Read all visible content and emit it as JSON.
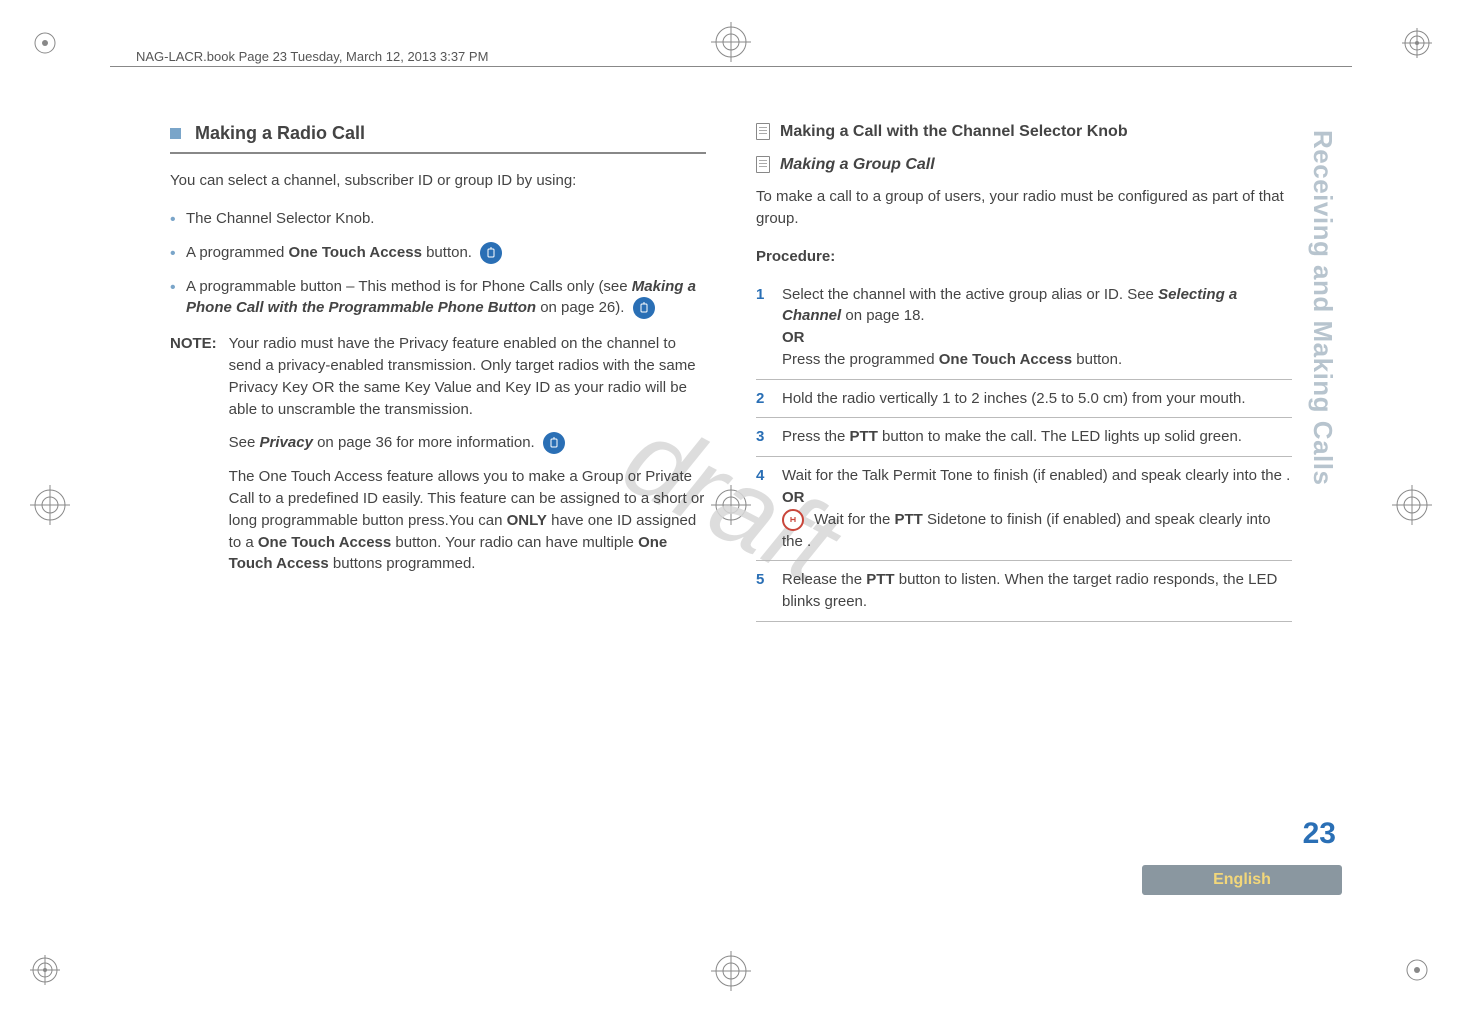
{
  "meta": {
    "header_line": "NAG-LACR.book  Page 23  Tuesday, March 12, 2013  3:37 PM",
    "watermark": "draft",
    "side_title": "Receiving and Making Calls",
    "page_number": "23",
    "language": "English"
  },
  "left": {
    "section_title": "Making a Radio Call",
    "intro": "You can select a channel, subscriber ID or group ID by using:",
    "bullets": {
      "b1": "The Channel Selector Knob.",
      "b2_pre": "A programmed ",
      "b2_bold": "One Touch Access",
      "b2_post": " button.  ",
      "b3_pre": "A programmable button – This method is for Phone Calls only (see ",
      "b3_ital": "Making a Phone Call with the Programmable Phone Button",
      "b3_post": " on page 26).  "
    },
    "note_label": "NOTE:",
    "note_p1": "Your radio must have the Privacy feature enabled on the channel to send a privacy-enabled transmission. Only target radios with the same Privacy Key OR the same Key Value and Key ID as your radio will be able to unscramble the transmission.",
    "note_p2_pre": "See ",
    "note_p2_ital": "Privacy",
    "note_p2_post": " on page 36 for more information.  ",
    "note_p3_a": "The One Touch Access feature allows you to make a Group or Private Call to a predefined ID easily. This feature can be assigned to a short or long programmable button press.You can ",
    "note_p3_b": "ONLY",
    "note_p3_c": " have one ID assigned to a ",
    "note_p3_d": "One Touch Access",
    "note_p3_e": " button. Your radio can have multiple ",
    "note_p3_f": "One Touch Access",
    "note_p3_g": " buttons programmed."
  },
  "right": {
    "subhead1": "Making a Call with the Channel Selector Knob",
    "subhead2": "Making a Group Call",
    "intro": "To make a call to a group of users, your radio must be configured as part of that group.",
    "procedure_label": "Procedure:",
    "steps": {
      "s1n": "1",
      "s1a": "Select the channel with the active group alias or ID. See ",
      "s1b": "Selecting a Channel",
      "s1c": " on page 18.",
      "s1_or": "OR",
      "s1d": "Press the programmed ",
      "s1e": "One Touch Access",
      "s1f": " button.",
      "s2n": "2",
      "s2": "Hold the radio vertically 1 to 2 inches (2.5 to 5.0 cm) from your mouth.",
      "s3n": "3",
      "s3a": "Press the ",
      "s3b": "PTT",
      "s3c": " button to make the call. The LED lights up solid green.",
      "s4n": "4",
      "s4a": "Wait for the Talk Permit Tone to finish (if enabled) and speak clearly into the .",
      "s4_or": "OR",
      "s4b": " Wait for the ",
      "s4c": "PTT",
      "s4d": " Sidetone to finish (if enabled) and speak clearly into the .",
      "s5n": "5",
      "s5a": "Release the ",
      "s5b": "PTT",
      "s5c": " button to listen. When the target radio responds, the LED blinks green."
    }
  }
}
